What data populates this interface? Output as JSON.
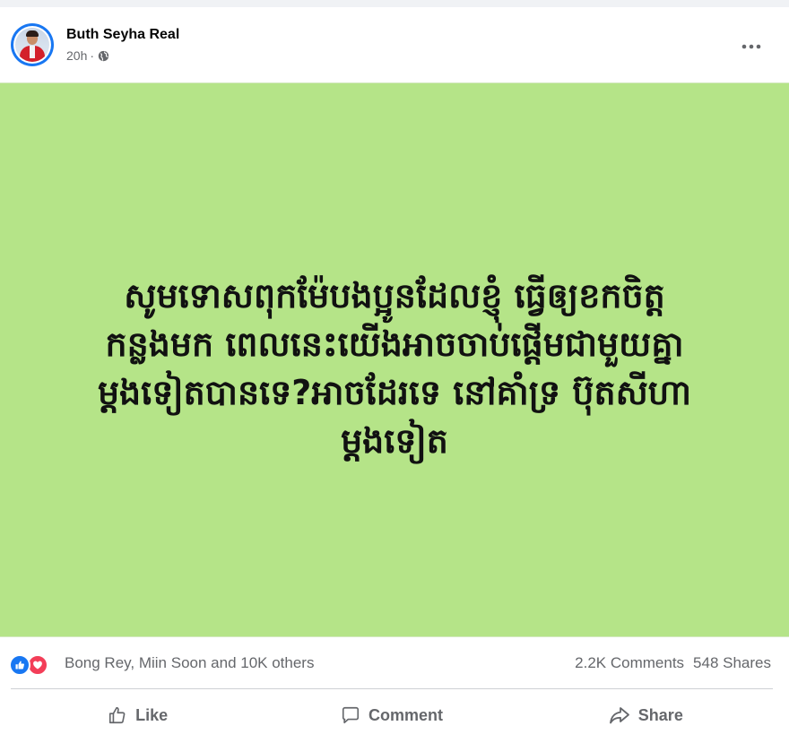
{
  "post": {
    "author": "Buth Seyha Real",
    "time": "20h",
    "separator": "·",
    "privacy_icon": "globe-icon",
    "more_icon": "more-options-icon",
    "image_background": "#b5e488",
    "image_text_lines": [
      "សូមទោសពុកម៉ែបងប្អូនដែលខ្ញុំ ធ្វើឲ្យខកចិត្ត",
      "កន្លងមក ពេលនេះយើងអាចចាប់ផ្តើមជាមួយគ្នា",
      "ម្តងទៀតបានទេ?អាចដែរទេ នៅគាំទ្រ ប៊ុតសីហា",
      "ម្តងទៀត"
    ]
  },
  "engagement": {
    "reaction_icons": [
      "like-reaction-icon",
      "love-reaction-icon"
    ],
    "reactors": "Bong Rey, Miin Soon and 10K others",
    "comments": "2.2K Comments",
    "shares": "548 Shares"
  },
  "actions": {
    "like": "Like",
    "comment": "Comment",
    "share": "Share"
  },
  "colors": {
    "facebook_blue": "#1877f2",
    "love_red": "#f33e58",
    "secondary_text": "#65676b"
  }
}
